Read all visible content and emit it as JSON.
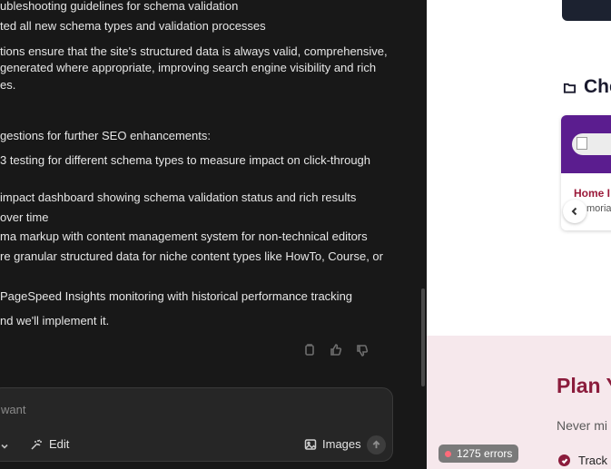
{
  "chat": {
    "lines": [
      "ubleshooting guidelines for schema validation",
      "ted all new schema types and validation processes",
      "tions ensure that the site's structured data is always valid, comprehensive,",
      "generated where appropriate, improving search engine visibility and rich",
      "es.",
      "gestions for further SEO enhancements:",
      "3 testing for different schema types to measure impact on click-through",
      " impact dashboard showing schema validation status and rich results",
      "over time",
      "ma markup with content management system for non-technical editors",
      "re granular structured data for niche content types like HowTo, Course, or",
      " PageSpeed Insights monitoring with historical performance tracking",
      "nd we'll implement it."
    ],
    "message_actions": [
      "copy-icon",
      "thumbs-up-icon",
      "thumbs-down-icon"
    ]
  },
  "composer": {
    "placeholder": "want",
    "edit_label": "Edit",
    "images_label": "Images"
  },
  "preview": {
    "section_title": "Che",
    "card": {
      "title": "Home I",
      "subtitle": "moria"
    },
    "plan": {
      "title": "Plan Y",
      "subtitle": "Never mi",
      "item": "Track"
    },
    "errors_badge": "1275 errors"
  },
  "colors": {
    "chat_bg": "#181818",
    "composer_bg": "#262626",
    "accent": "#8b1c3c",
    "card_header": "#5b1d8f",
    "plan_bg": "#f6e8ec",
    "error_dot": "#ff6b7a"
  }
}
